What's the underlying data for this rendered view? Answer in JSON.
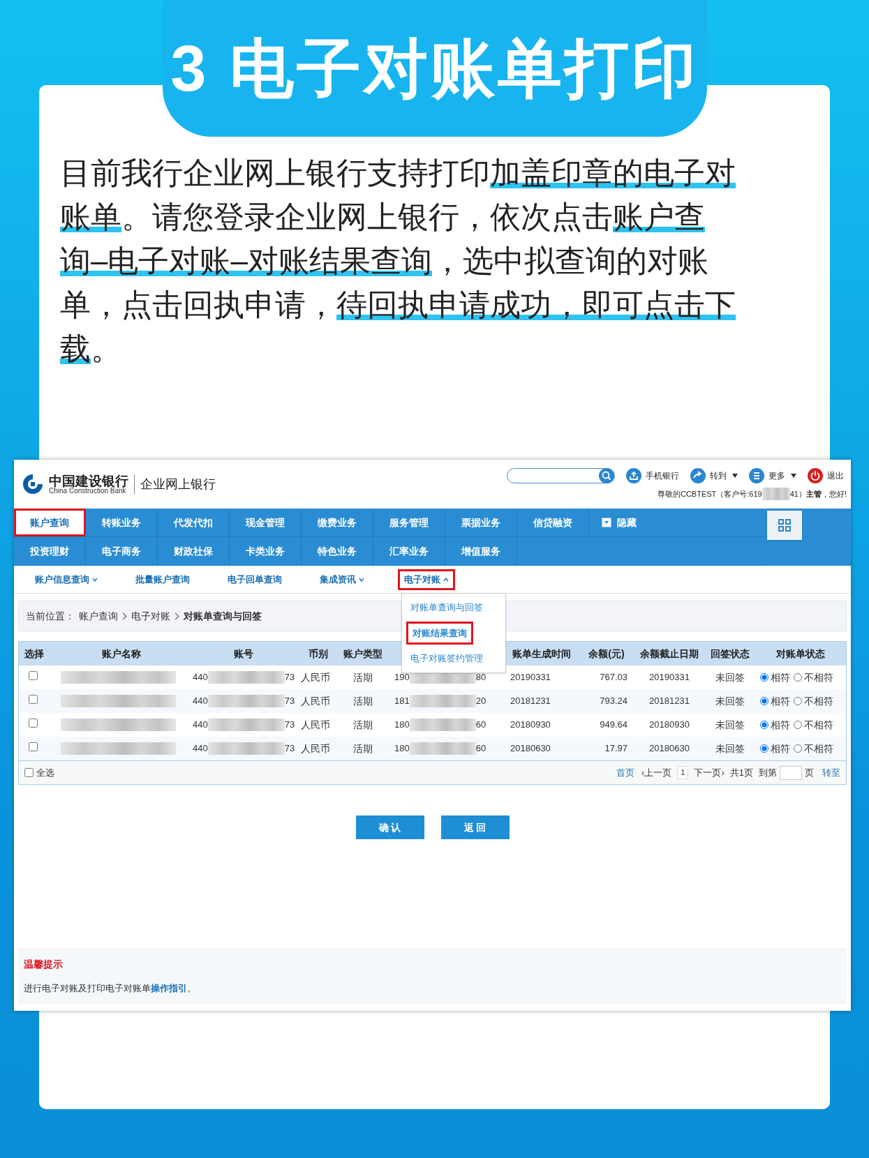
{
  "banner": {
    "title": "3 电子对账单打印"
  },
  "intro": [
    {
      "text": "目前我行企业网上银行支持打印",
      "highlight": false
    },
    {
      "text": "加盖印章的电子对账单",
      "highlight": true
    },
    {
      "text": "。请您登录企业网上银行，依次点击",
      "highlight": false
    },
    {
      "text": "账户查询–电子对账–对账结果查询",
      "highlight": true
    },
    {
      "text": "，选中拟查询的对账单，点击回执申请，",
      "highlight": false
    },
    {
      "text": "待回执申请成功，即可点击下载",
      "highlight": true
    },
    {
      "text": "。",
      "highlight": false
    }
  ],
  "app": {
    "logo": {
      "name": "中国建设银行",
      "english": "China Construction Bank",
      "product": "企业网上银行"
    },
    "toolbar": [
      {
        "kind": "mobile",
        "label": "手机银行",
        "caret": false
      },
      {
        "kind": "goto",
        "label": "转到",
        "caret": true
      },
      {
        "kind": "more",
        "label": "更多",
        "caret": true
      },
      {
        "kind": "logout",
        "label": "退出",
        "caret": false
      }
    ],
    "greeting": {
      "before": "尊敬的CCBTEST（客户号:619",
      "after": "41）",
      "role": "主管",
      "end": "，您好!"
    },
    "nav": [
      [
        {
          "label": "账户查询",
          "selected": true,
          "highlighted": true
        },
        {
          "label": "转账业务",
          "selected": false,
          "highlighted": false
        },
        {
          "label": "代发代扣",
          "selected": false,
          "highlighted": false
        },
        {
          "label": "现金管理",
          "selected": false,
          "highlighted": false
        },
        {
          "label": "缴费业务",
          "selected": false,
          "highlighted": false
        },
        {
          "label": "服务管理",
          "selected": false,
          "highlighted": false
        },
        {
          "label": "票据业务",
          "selected": false,
          "highlighted": false
        },
        {
          "label": "信贷融资",
          "selected": false,
          "highlighted": false
        }
      ],
      [
        {
          "label": "投资理财",
          "selected": false,
          "highlighted": false
        },
        {
          "label": "电子商务",
          "selected": false,
          "highlighted": false
        },
        {
          "label": "财政社保",
          "selected": false,
          "highlighted": false
        },
        {
          "label": "卡类业务",
          "selected": false,
          "highlighted": false
        },
        {
          "label": "特色业务",
          "selected": false,
          "highlighted": false
        },
        {
          "label": "汇率业务",
          "selected": false,
          "highlighted": false
        },
        {
          "label": "增值服务",
          "selected": false,
          "highlighted": false
        }
      ]
    ],
    "nav_toggle": {
      "label": "隐藏"
    },
    "submenu": [
      {
        "kind": "menu",
        "label": "账户信息查询",
        "expanded": false,
        "highlighted": false
      },
      {
        "kind": "link",
        "label": "批量账户查询",
        "highlighted": false
      },
      {
        "kind": "link",
        "label": "电子回单查询",
        "highlighted": false
      },
      {
        "kind": "menu",
        "label": "集成资讯",
        "expanded": false,
        "highlighted": false
      },
      {
        "kind": "menu",
        "label": "电子对账",
        "expanded": true,
        "highlighted": true
      }
    ],
    "dropdown": [
      {
        "label": "对账单查询与回签",
        "highlighted": false
      },
      {
        "label": "对账结果查询",
        "highlighted": true
      },
      {
        "label": "电子对账签约管理",
        "highlighted": false
      }
    ],
    "breadcrumb": {
      "label": "当前位置：",
      "items": [
        "账户查询",
        "电子对账",
        "对账单查询与回签"
      ]
    },
    "table": {
      "columns": [
        "选择",
        "账户名称",
        "账号",
        "币别",
        "账户类型",
        "",
        "账单生成时间",
        "余额(元)",
        "余额截止日期",
        "回签状态",
        "对账单状态"
      ],
      "rows": [
        {
          "checked": false,
          "account_start": "440",
          "account_end": "73",
          "currency": "人民币",
          "type": "活期",
          "statement_start": "190",
          "statement_end": "80",
          "generated": "20190331",
          "balance": "767.03",
          "balance_date": "20190331",
          "sign_status": "未回签",
          "match": true,
          "match_label": "相符",
          "mismatch_label": "不相符"
        },
        {
          "checked": false,
          "account_start": "440",
          "account_end": "73",
          "currency": "人民币",
          "type": "活期",
          "statement_start": "181",
          "statement_end": "20",
          "generated": "20181231",
          "balance": "793.24",
          "balance_date": "20181231",
          "sign_status": "未回签",
          "match": true,
          "match_label": "相符",
          "mismatch_label": "不相符"
        },
        {
          "checked": false,
          "account_start": "440",
          "account_end": "73",
          "currency": "人民币",
          "type": "活期",
          "statement_start": "180",
          "statement_end": "60",
          "generated": "20180930",
          "balance": "949.64",
          "balance_date": "20180930",
          "sign_status": "未回签",
          "match": true,
          "match_label": "相符",
          "mismatch_label": "不相符"
        },
        {
          "checked": false,
          "account_start": "440",
          "account_end": "73",
          "currency": "人民币",
          "type": "活期",
          "statement_start": "180",
          "statement_end": "60",
          "generated": "20180630",
          "balance": "17.97",
          "balance_date": "20180630",
          "sign_status": "未回签",
          "match": true,
          "match_label": "相符",
          "mismatch_label": "不相符"
        }
      ],
      "select_all": {
        "label": "全选",
        "checked": false
      },
      "pager": {
        "first": "首页",
        "prev": "‹上一页",
        "page": "1",
        "next": "下一页›",
        "total": "共1页",
        "goto_before": "到第",
        "goto_after": "页",
        "go": "转至"
      }
    },
    "buttons": [
      "确 认",
      "返 回"
    ],
    "tip": {
      "title": "温馨提示",
      "before": "进行电子对账及打印电子对账单",
      "link": "操作指引",
      "after": "。"
    }
  }
}
